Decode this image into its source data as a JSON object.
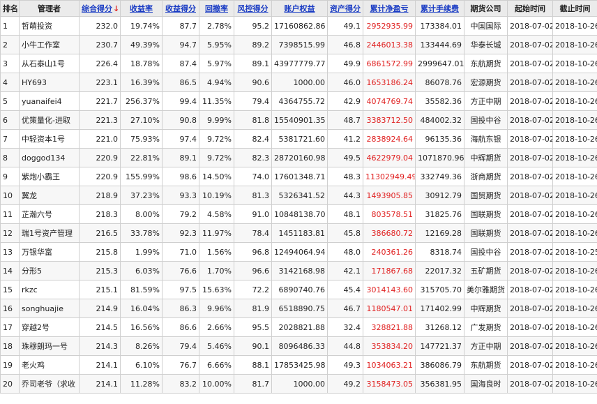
{
  "columns": [
    {
      "key": "rank",
      "label": "排名",
      "sortable": false
    },
    {
      "key": "manager",
      "label": "管理者",
      "sortable": false
    },
    {
      "key": "score",
      "label": "综合得分",
      "sortable": true,
      "active_sort": true
    },
    {
      "key": "return_rate",
      "label": "收益率",
      "sortable": true
    },
    {
      "key": "return_score",
      "label": "收益得分",
      "sortable": true
    },
    {
      "key": "drawdown",
      "label": "回撤率",
      "sortable": true
    },
    {
      "key": "risk_score",
      "label": "风控得分",
      "sortable": true
    },
    {
      "key": "equity",
      "label": "账户权益",
      "sortable": true
    },
    {
      "key": "asset_score",
      "label": "资产得分",
      "sortable": true
    },
    {
      "key": "net_profit",
      "label": "累计净盈亏",
      "sortable": true
    },
    {
      "key": "fee",
      "label": "累计手续费",
      "sortable": true
    },
    {
      "key": "broker",
      "label": "期货公司",
      "sortable": false
    },
    {
      "key": "start",
      "label": "起始时间",
      "sortable": false
    },
    {
      "key": "end",
      "label": "截止时间",
      "sortable": false
    }
  ],
  "sort_indicator": "↓",
  "colors": {
    "profit_red": "#e02020",
    "link_blue": "#1a3cc4",
    "header_bg": "#ebebeb"
  },
  "rows": [
    [
      "1",
      "哲萌投资",
      "232.0",
      "19.74%",
      "87.7",
      "2.78%",
      "95.2",
      "17160862.86",
      "49.1",
      "2952935.99",
      "173384.01",
      "中国国际",
      "2018-07-02",
      "2018-10-26"
    ],
    [
      "2",
      "小牛工作室",
      "230.7",
      "49.39%",
      "94.7",
      "5.95%",
      "89.2",
      "7398515.99",
      "46.8",
      "2446013.38",
      "133444.69",
      "华泰长城",
      "2018-07-02",
      "2018-10-26"
    ],
    [
      "3",
      "从石泰山1号",
      "226.4",
      "18.78%",
      "87.4",
      "5.97%",
      "89.1",
      "43977779.77",
      "49.9",
      "6861572.99",
      "2999647.01",
      "东航期货",
      "2018-07-02",
      "2018-10-26"
    ],
    [
      "4",
      "HY693",
      "223.1",
      "16.39%",
      "86.5",
      "4.94%",
      "90.6",
      "1000.00",
      "46.0",
      "1653186.24",
      "86078.76",
      "宏源期货",
      "2018-07-02",
      "2018-10-26"
    ],
    [
      "5",
      "yuanaifei4",
      "221.7",
      "256.37%",
      "99.4",
      "11.35%",
      "79.4",
      "4364755.72",
      "42.9",
      "4074769.74",
      "35582.36",
      "方正中期",
      "2018-07-02",
      "2018-10-26"
    ],
    [
      "6",
      "优策量化-进取",
      "221.3",
      "27.10%",
      "90.8",
      "9.99%",
      "81.8",
      "15540901.35",
      "48.7",
      "3383712.50",
      "484002.32",
      "国投中谷",
      "2018-07-02",
      "2018-10-26"
    ],
    [
      "7",
      "中轻资本1号",
      "221.0",
      "75.93%",
      "97.4",
      "9.72%",
      "82.4",
      "5381721.60",
      "41.2",
      "2838924.64",
      "96135.36",
      "海航东银",
      "2018-07-02",
      "2018-10-26"
    ],
    [
      "8",
      "doggod134",
      "220.9",
      "22.81%",
      "89.1",
      "9.72%",
      "82.3",
      "28720160.98",
      "49.5",
      "4622979.04",
      "1071870.96",
      "中辉期货",
      "2018-07-02",
      "2018-10-26"
    ],
    [
      "9",
      "紫炮小霸王",
      "220.9",
      "155.99%",
      "98.6",
      "14.50%",
      "74.0",
      "17601348.71",
      "48.3",
      "11302949.49",
      "332749.36",
      "浙商期货",
      "2018-07-02",
      "2018-10-26"
    ],
    [
      "10",
      "翼龙",
      "218.9",
      "37.23%",
      "93.3",
      "10.19%",
      "81.3",
      "5326341.52",
      "44.3",
      "1493905.85",
      "30912.79",
      "国贸期货",
      "2018-07-02",
      "2018-10-26"
    ],
    [
      "11",
      "芷瀚六号",
      "218.3",
      "8.00%",
      "79.2",
      "4.58%",
      "91.0",
      "10848138.70",
      "48.1",
      "803578.51",
      "31825.76",
      "国联期货",
      "2018-07-02",
      "2018-10-26"
    ],
    [
      "12",
      "瑞1号资产管理",
      "216.5",
      "33.78%",
      "92.3",
      "11.97%",
      "78.4",
      "1451183.81",
      "45.8",
      "386680.72",
      "12169.28",
      "国联期货",
      "2018-07-02",
      "2018-10-26"
    ],
    [
      "13",
      "万银华富",
      "215.8",
      "1.99%",
      "71.0",
      "1.56%",
      "96.8",
      "12494064.94",
      "48.0",
      "240361.26",
      "8318.74",
      "国投中谷",
      "2018-07-02",
      "2018-10-25"
    ],
    [
      "14",
      "分形5",
      "215.3",
      "6.03%",
      "76.6",
      "1.70%",
      "96.6",
      "3142168.98",
      "42.1",
      "171867.68",
      "22017.32",
      "五矿期货",
      "2018-07-02",
      "2018-10-26"
    ],
    [
      "15",
      "rkzc",
      "215.1",
      "81.59%",
      "97.5",
      "15.63%",
      "72.2",
      "6890740.76",
      "45.4",
      "3014143.60",
      "315705.70",
      "美尔雅期货",
      "2018-07-02",
      "2018-10-26"
    ],
    [
      "16",
      "songhuajie",
      "214.9",
      "16.04%",
      "86.3",
      "9.96%",
      "81.9",
      "6518890.75",
      "46.7",
      "1180547.01",
      "171402.99",
      "中辉期货",
      "2018-07-02",
      "2018-10-26"
    ],
    [
      "17",
      "穿越2号",
      "214.5",
      "16.56%",
      "86.6",
      "2.66%",
      "95.5",
      "2028821.88",
      "32.4",
      "328821.88",
      "31268.12",
      "广发期货",
      "2018-07-02",
      "2018-10-26"
    ],
    [
      "18",
      "珠穆朗玛一号",
      "214.3",
      "8.26%",
      "79.4",
      "5.46%",
      "90.1",
      "8096486.33",
      "44.8",
      "353834.20",
      "147721.37",
      "方正中期",
      "2018-07-02",
      "2018-10-26"
    ],
    [
      "19",
      "老火鸡",
      "214.1",
      "6.10%",
      "76.7",
      "6.66%",
      "88.1",
      "17853425.98",
      "49.3",
      "1034063.21",
      "386086.79",
      "东航期货",
      "2018-07-02",
      "2018-10-26"
    ],
    [
      "20",
      "乔司老爷（求收",
      "214.1",
      "11.28%",
      "83.2",
      "10.00%",
      "81.7",
      "1000.00",
      "49.2",
      "3158473.05",
      "356381.95",
      "国海良时",
      "2018-07-02",
      "2018-10-26"
    ]
  ]
}
